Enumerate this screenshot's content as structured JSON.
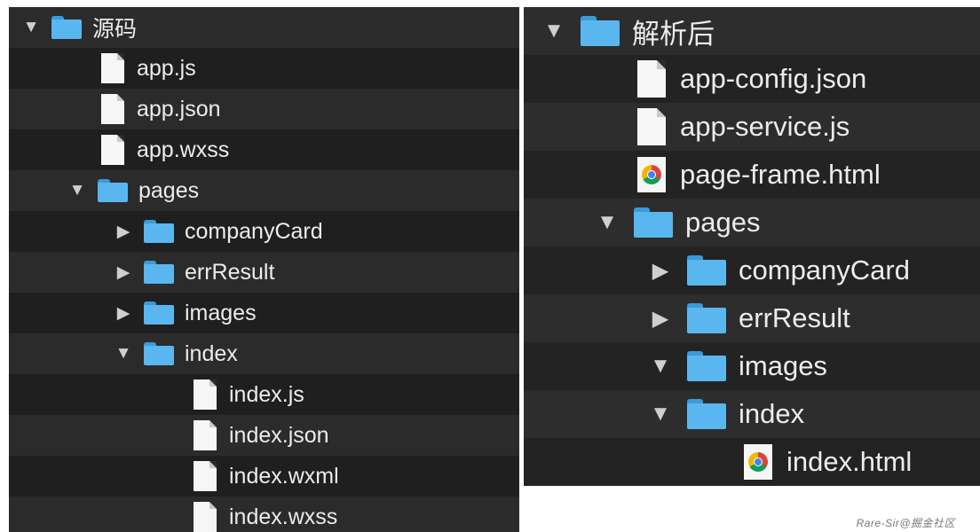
{
  "left": {
    "rows": [
      {
        "label": "源码",
        "kind": "folder",
        "expanded": true,
        "depth": 0
      },
      {
        "label": "app.js",
        "kind": "file",
        "depth": 1
      },
      {
        "label": "app.json",
        "kind": "file",
        "depth": 1
      },
      {
        "label": "app.wxss",
        "kind": "file",
        "depth": 1
      },
      {
        "label": "pages",
        "kind": "folder",
        "expanded": true,
        "depth": 1
      },
      {
        "label": "companyCard",
        "kind": "folder",
        "expanded": false,
        "depth": 2
      },
      {
        "label": "errResult",
        "kind": "folder",
        "expanded": false,
        "depth": 2
      },
      {
        "label": "images",
        "kind": "folder",
        "expanded": false,
        "depth": 2
      },
      {
        "label": "index",
        "kind": "folder",
        "expanded": true,
        "depth": 2
      },
      {
        "label": "index.js",
        "kind": "file",
        "depth": 3
      },
      {
        "label": "index.json",
        "kind": "file",
        "depth": 3
      },
      {
        "label": "index.wxml",
        "kind": "file",
        "depth": 3
      },
      {
        "label": "index.wxss",
        "kind": "file",
        "depth": 3
      }
    ]
  },
  "right": {
    "rows": [
      {
        "label": "解析后",
        "kind": "folder",
        "expanded": true,
        "depth": 0
      },
      {
        "label": "app-config.json",
        "kind": "file",
        "depth": 1
      },
      {
        "label": "app-service.js",
        "kind": "file",
        "depth": 1
      },
      {
        "label": "page-frame.html",
        "kind": "html",
        "depth": 1
      },
      {
        "label": "pages",
        "kind": "folder",
        "expanded": true,
        "depth": 1
      },
      {
        "label": "companyCard",
        "kind": "folder",
        "expanded": false,
        "depth": 2
      },
      {
        "label": "errResult",
        "kind": "folder",
        "expanded": false,
        "depth": 2
      },
      {
        "label": "images",
        "kind": "folder",
        "expanded": true,
        "depth": 2
      },
      {
        "label": "index",
        "kind": "folder",
        "expanded": true,
        "depth": 2
      },
      {
        "label": "index.html",
        "kind": "html",
        "depth": 3
      }
    ]
  },
  "icons": {
    "expanded": "▼",
    "collapsed": "▶",
    "folder": "folder-icon",
    "file": "file-icon",
    "html": "chrome-html-icon"
  },
  "colors": {
    "folder": "#5ab6ef",
    "row_dark": "#1f1f1f",
    "row_light": "#2b2b2b",
    "text": "#ececec"
  },
  "watermark": "Rare-Sir@掘金社区"
}
